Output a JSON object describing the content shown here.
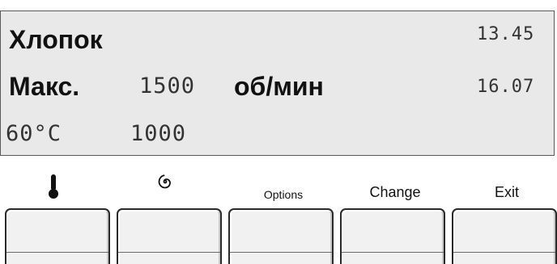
{
  "display": {
    "program": "Хлопок",
    "time_top": "13.45",
    "spin_prefix": "Макс.",
    "spin_value": "1500",
    "spin_unit": "об/мин",
    "time_second": "16.07",
    "temperature": "60°C",
    "spin_small": "1000",
    "lcd_background": "#e9e9e9"
  },
  "softkeys": [
    {
      "label": "",
      "icon": "thermometer-icon"
    },
    {
      "label": "",
      "icon": "spin-spiral-icon"
    },
    {
      "label": "Options",
      "icon": ""
    },
    {
      "label": "Change",
      "icon": ""
    },
    {
      "label": "Exit",
      "icon": ""
    }
  ]
}
